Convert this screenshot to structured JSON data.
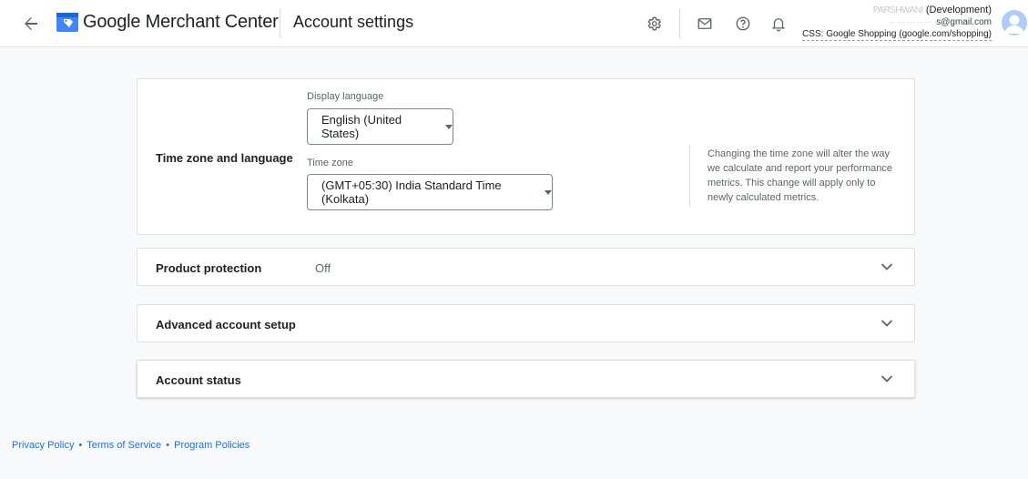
{
  "header": {
    "product_google": "Google",
    "product_rest": " Merchant Center",
    "page_title": "Account settings",
    "account_name_blurred": "PARSHWANI",
    "account_name_suffix": " (Development)",
    "account_email_blurred": "·· ··· ··· ·· ··· ·",
    "account_email_suffix": "s@gmail.com",
    "css_label": "CSS: Google Shopping (google.com/shopping)"
  },
  "time_zone_section": {
    "title": "Time zone and language",
    "display_language_label": "Display language",
    "display_language_value": "English (United States)",
    "time_zone_label": "Time zone",
    "time_zone_value": "(GMT+05:30) India Standard Time (Kolkata)",
    "help_text": "Changing the time zone will alter the way we calculate and report your performance metrics. This change will apply only to newly calculated metrics."
  },
  "rows": [
    {
      "title": "Product protection",
      "value": "Off"
    },
    {
      "title": "Advanced account setup",
      "value": ""
    },
    {
      "title": "Account status",
      "value": ""
    }
  ],
  "footer": {
    "privacy": "Privacy Policy",
    "terms": "Terms of Service",
    "policies": "Program Policies",
    "separator": "•"
  },
  "icons": {
    "back": "arrow-back-icon",
    "settings": "gear-icon",
    "mail": "mail-icon",
    "help": "help-icon",
    "notifications": "bell-icon",
    "expand": "chevron-down-icon"
  },
  "colors": {
    "brand_blue": "#1a73e8",
    "text": "#202124",
    "muted": "#5f6368"
  }
}
